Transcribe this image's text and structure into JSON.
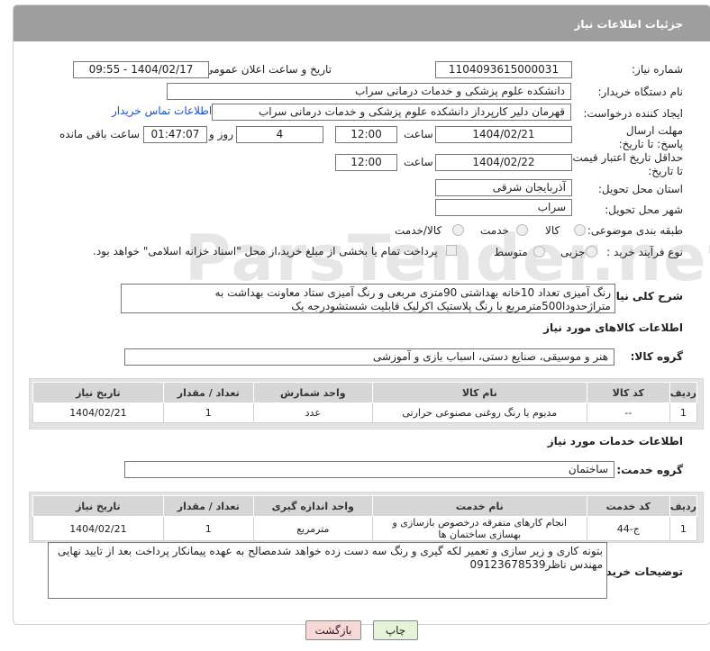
{
  "header": {
    "title": "جزئیات اطلاعات نیاز"
  },
  "need_number": {
    "label": "شماره نیاز:",
    "value": "1104093615000031"
  },
  "announce": {
    "label": "تاریخ و ساعت اعلان عمومی:",
    "value": "1404/02/17 - 09:55"
  },
  "buyer_org": {
    "label": "نام دستگاه خریدار:",
    "value": "دانشکده علوم پزشکی و خدمات درمانی سراب"
  },
  "creator": {
    "label": "ایجاد کننده درخواست:",
    "value": "قهرمان دلیر کارپرداز دانشکده علوم پزشکی و خدمات درمانی سراب",
    "contact_link": "اطلاعات تماس خریدار"
  },
  "reply_deadline": {
    "label": "مهلت ارسال پاسخ: تا تاریخ:",
    "date": "1404/02/21",
    "time_label": "ساعت",
    "time": "12:00",
    "days": "4",
    "days_label": "روز و",
    "remaining": "01:47:07",
    "remaining_label": "ساعت باقی مانده"
  },
  "price_validity": {
    "label": "حداقل تاریخ اعتبار قیمت: تا تاریخ:",
    "date": "1404/02/22",
    "time_label": "ساعت",
    "time": "12:00"
  },
  "province": {
    "label": "استان محل تحویل:",
    "value": "آذربایجان شرقی"
  },
  "city": {
    "label": "شهر محل تحویل:",
    "value": "سراب"
  },
  "category": {
    "label": "طبقه بندی موضوعی:",
    "options": [
      "کالا",
      "خدمت",
      "کالا/خدمت"
    ]
  },
  "process": {
    "label": "نوع فرآیند خرید :",
    "options": [
      "جزیی",
      "متوسط"
    ],
    "note": "پرداخت تمام یا بخشی از مبلغ خرید،از محل \"اسناد خزانه اسلامی\" خواهد بود."
  },
  "description": {
    "label": "شرح کلی نیاز:",
    "value": "رنگ آمیزی تعداد 10خانه بهداشتی 90متری مربعی و رنگ آمیزی ستاد معاونت بهداشت به متراژحدودا500مترمربع با رنگ پلاستیک اکرلیک قابلیت شستشودرجه یک"
  },
  "goods_section": {
    "title": "اطلاعات کالاهای مورد نیاز",
    "group_label": "گروه کالا:",
    "group_value": "هنر و موسیقی، صنایع دستی، اسباب بازی و آموزشی",
    "columns": [
      "ردیف",
      "کد کالا",
      "نام کالا",
      "واحد شمارش",
      "تعداد / مقدار",
      "تاریخ نیاز"
    ],
    "rows": [
      {
        "row": "1",
        "code": "--",
        "name": "مدیوم یا رنگ روغنی مصنوعی حرارتی",
        "unit": "عدد",
        "qty": "1",
        "date": "1404/02/21"
      }
    ]
  },
  "services_section": {
    "title": "اطلاعات خدمات مورد نیاز",
    "group_label": "گروه خدمت:",
    "group_value": "ساختمان",
    "columns": [
      "ردیف",
      "کد خدمت",
      "نام خدمت",
      "واحد اندازه گیری",
      "تعداد / مقدار",
      "تاریخ نیاز"
    ],
    "rows": [
      {
        "row": "1",
        "code": "ج-44",
        "name": "انجام کارهای متفرقه درخصوص بازسازی و بهسازی ساختمان ها",
        "unit": "مترمربع",
        "qty": "1",
        "date": "1404/02/21"
      }
    ]
  },
  "buyer_notes": {
    "label": "توضیحات خریدار:",
    "value": "بتونه کاری و زیر سازی و تعمیر لکه گیری و رنگ سه دست زده خواهد شدمصالح به عهده پیمانکار پرداخت بعد از تایید نهایی مهندس ناظر09123678539"
  },
  "buttons": {
    "print": "چاپ",
    "back": "بازگشت"
  },
  "colors": {
    "header_bg": "#9e9e9e",
    "table_header": "#d6d6d6",
    "link": "#1a4fc9",
    "back_button": "#f8d7d7",
    "print_button": "#e6f3d8"
  }
}
